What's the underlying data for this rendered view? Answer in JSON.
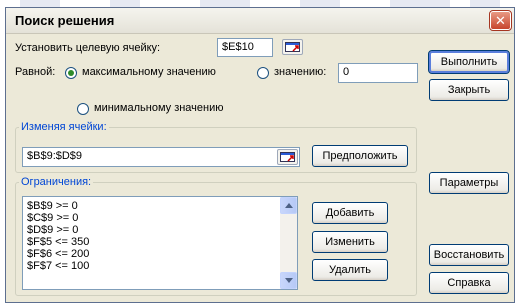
{
  "window": {
    "title": "Поиск решения",
    "close_glyph": "✕"
  },
  "target": {
    "label": "Установить целевую ячейку:",
    "value": "$E$10"
  },
  "equal": {
    "label": "Равной:",
    "max_label": "максимальному значению",
    "value_label": "значению:",
    "value": "0",
    "min_label": "минимальному значению",
    "selected": "max"
  },
  "changing": {
    "legend": "Изменяя ячейки:",
    "value": "$B$9:$D$9",
    "guess_button": "Предположить"
  },
  "constraints": {
    "legend": "Ограничения:",
    "items": [
      "$B$9 >= 0",
      "$C$9 >= 0",
      "$D$9 >= 0",
      "$F$5 <= 350",
      "$F$6 <= 200",
      "$F$7 <= 100"
    ],
    "add_button": "Добавить",
    "change_button": "Изменить",
    "delete_button": "Удалить"
  },
  "buttons": {
    "solve": "Выполнить",
    "close": "Закрыть",
    "options": "Параметры",
    "reset": "Восстановить",
    "help": "Справка"
  },
  "colors": {
    "accent": "#0046d5",
    "title_bg": "#ece9d8",
    "close": "#c7452d"
  }
}
